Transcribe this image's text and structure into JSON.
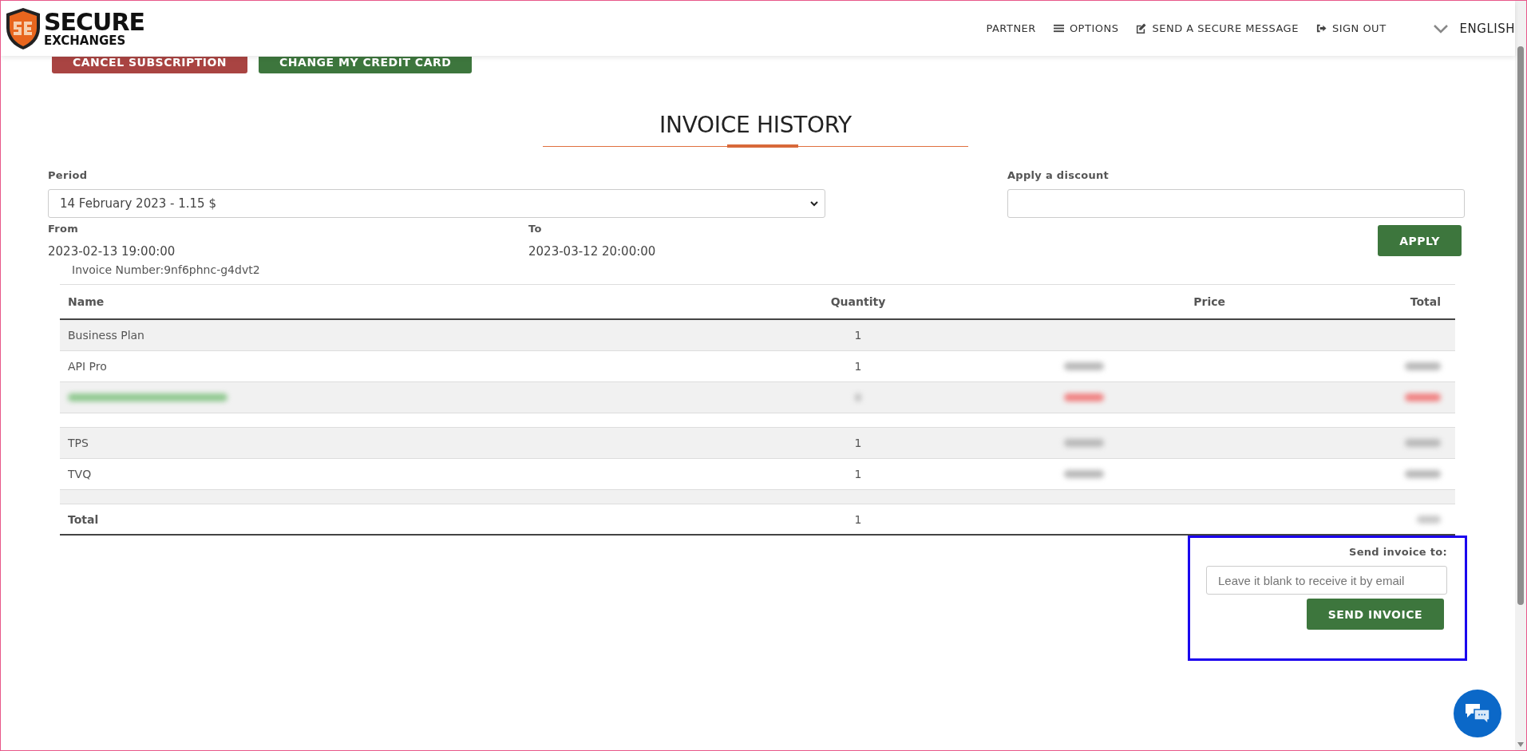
{
  "header": {
    "logo_top": "SECURE",
    "logo_bottom": "EXCHANGES",
    "nav": [
      {
        "label": "PARTNER"
      },
      {
        "label": "OPTIONS"
      },
      {
        "label": "SEND A SECURE MESSAGE"
      },
      {
        "label": "SIGN OUT"
      }
    ],
    "language": "ENGLISH"
  },
  "actions": [
    {
      "label": "CANCEL SUBSCRIPTION",
      "kind": "danger"
    },
    {
      "label": "CHANGE MY CREDIT CARD",
      "kind": "primary"
    }
  ],
  "title": "INVOICE HISTORY",
  "period": {
    "label": "Period",
    "value": "14 February 2023 - 1.15 $"
  },
  "discount": {
    "label": "Apply a discount",
    "button": "APPLY"
  },
  "from": {
    "label": "From",
    "value": "2023-02-13 19:00:00"
  },
  "to": {
    "label": "To",
    "value": "2023-03-12 20:00:00"
  },
  "invoice_number": "Invoice Number:9nf6phnc-g4dvt2",
  "table": {
    "columns": [
      "Name",
      "Quantity",
      "Price",
      "Total"
    ],
    "rows": [
      {
        "kind": "item",
        "name": "Business Plan",
        "quantity": "1",
        "amounts_blurred": false
      },
      {
        "kind": "item",
        "name": "API Pro",
        "quantity": "1",
        "amounts_blurred": true,
        "negative": false
      },
      {
        "kind": "blurred",
        "amounts_blurred": true,
        "negative": true
      },
      {
        "kind": "blank"
      },
      {
        "kind": "item",
        "name": "TPS",
        "quantity": "1",
        "amounts_blurred": true,
        "negative": false
      },
      {
        "kind": "item",
        "name": "TVQ",
        "quantity": "1",
        "amounts_blurred": true,
        "negative": false
      },
      {
        "kind": "blank"
      },
      {
        "kind": "total",
        "name": "Total",
        "quantity": "1",
        "amounts_blurred": true
      }
    ]
  },
  "send": {
    "label": "Send invoice to:",
    "placeholder": "Leave it blank to receive it by email",
    "button": "SEND INVOICE"
  }
}
